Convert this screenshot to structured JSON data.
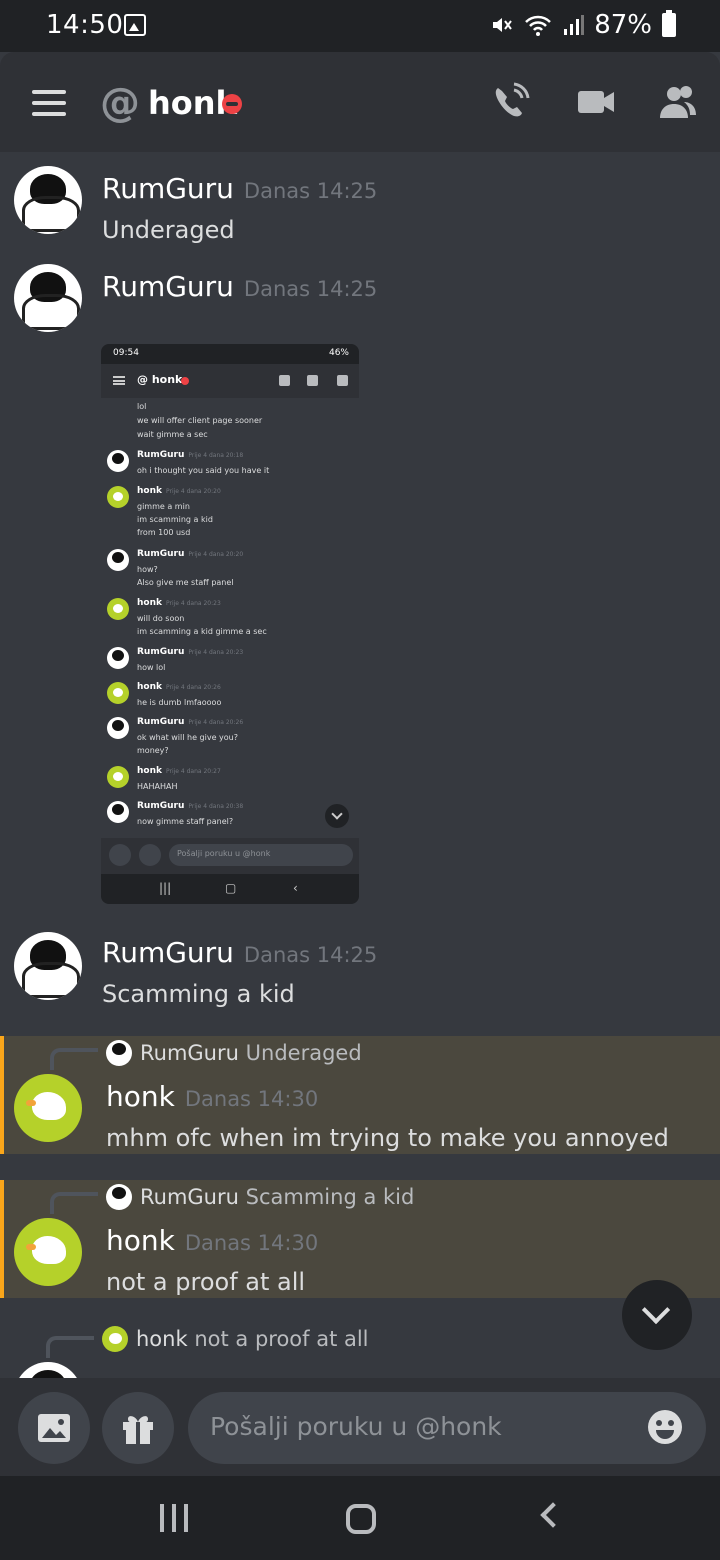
{
  "status_bar": {
    "time": "14:50",
    "battery": "87%"
  },
  "header": {
    "at": "@",
    "title": "honk"
  },
  "messages": [
    {
      "user": "RumGuru",
      "time": "Danas 14:25",
      "text": "Underaged"
    },
    {
      "user": "RumGuru",
      "time": "Danas 14:25"
    },
    {
      "user": "RumGuru",
      "time": "Danas 14:25",
      "text": "Scamming a kid"
    },
    {
      "reply_user": "RumGuru",
      "reply_text": "Underaged",
      "user": "honk",
      "time": "Danas 14:30",
      "text": "mhm ofc when im trying to make you annoyed"
    },
    {
      "reply_user": "RumGuru",
      "reply_text": "Scamming a kid",
      "user": "honk",
      "time": "Danas 14:30",
      "text": "not a proof at all"
    },
    {
      "reply_user": "honk",
      "reply_text": "not a proof at all"
    }
  ],
  "embed": {
    "status_time": "09:54",
    "status_right": "46%",
    "title": "@ honk",
    "lines": [
      "lol",
      "we will offer client page sooner",
      "wait gimme a sec",
      "oh i thought you said you have it",
      "gimme a min",
      "im scamming a kid",
      "from 100 usd",
      "how?",
      "Also give me staff panel",
      "will do soon",
      "im scamming a kid gimme a sec",
      "how lol",
      "he is dumb lmfaoooo",
      "ok what will he give you?",
      "money?",
      "HAHAHAH",
      "now gimme staff panel?"
    ],
    "names": [
      {
        "user": "RumGuru",
        "time": "Prije 4 dana 20:18"
      },
      {
        "user": "honk",
        "time": "Prije 4 dana 20:20"
      },
      {
        "user": "RumGuru",
        "time": "Prije 4 dana 20:20"
      },
      {
        "user": "honk",
        "time": "Prije 4 dana 20:23"
      },
      {
        "user": "RumGuru",
        "time": "Prije 4 dana 20:23"
      },
      {
        "user": "honk",
        "time": "Prije 4 dana 20:26"
      },
      {
        "user": "RumGuru",
        "time": "Prije 4 dana 20:26"
      },
      {
        "user": "honk",
        "time": "Prije 4 dana 20:27"
      },
      {
        "user": "RumGuru",
        "time": "Prije 4 dana 20:38"
      }
    ],
    "input_placeholder": "Pošalji poruku u @honk"
  },
  "input": {
    "placeholder": "Pošalji poruku u @honk"
  },
  "icons": {
    "menu": "hamburger-icon",
    "call": "phone-icon",
    "video": "video-camera-icon",
    "members": "people-icon",
    "image": "image-icon",
    "gift": "gift-icon",
    "emoji": "emoji-icon"
  },
  "colors": {
    "dnd": "#ed4245",
    "reply_accent": "#faa61a",
    "background": "#36393f"
  }
}
